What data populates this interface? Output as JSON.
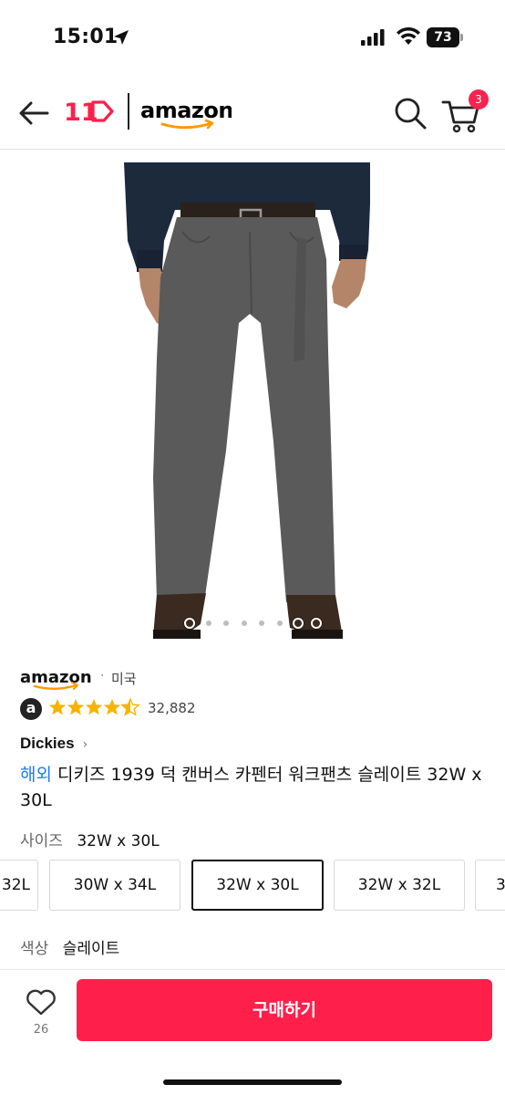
{
  "status_bar": {
    "time": "15:01",
    "battery": "73"
  },
  "header": {
    "logo_11": "11",
    "logo_amazon": "amazon",
    "cart_count": "3"
  },
  "carousel": {
    "total": 8,
    "active_index": 0
  },
  "seller": {
    "logo": "amazon",
    "separator": "·",
    "country": "미국"
  },
  "rating": {
    "badge": "a",
    "stars": 4.5,
    "count": "32,882"
  },
  "brand": {
    "name": "Dickies",
    "chevron": "›"
  },
  "title": {
    "tag": "해외",
    "text": " 디키즈 1939 덕 캔버스 카펜터 워크팬츠 슬레이트 32W x 30L"
  },
  "size": {
    "label": "사이즈",
    "selected": "32W x 30L",
    "options": [
      "32L",
      "30W x 34L",
      "32W x 30L",
      "32W x 32L",
      "3"
    ]
  },
  "color": {
    "label": "색상",
    "value": "슬레이트"
  },
  "bottom": {
    "like_count": "26",
    "buy_label": "구매하기"
  },
  "colors": {
    "accent": "#ff1f4b",
    "overseas": "#1d7cf2",
    "star": "#f5b400",
    "badge": "#f8234f"
  }
}
